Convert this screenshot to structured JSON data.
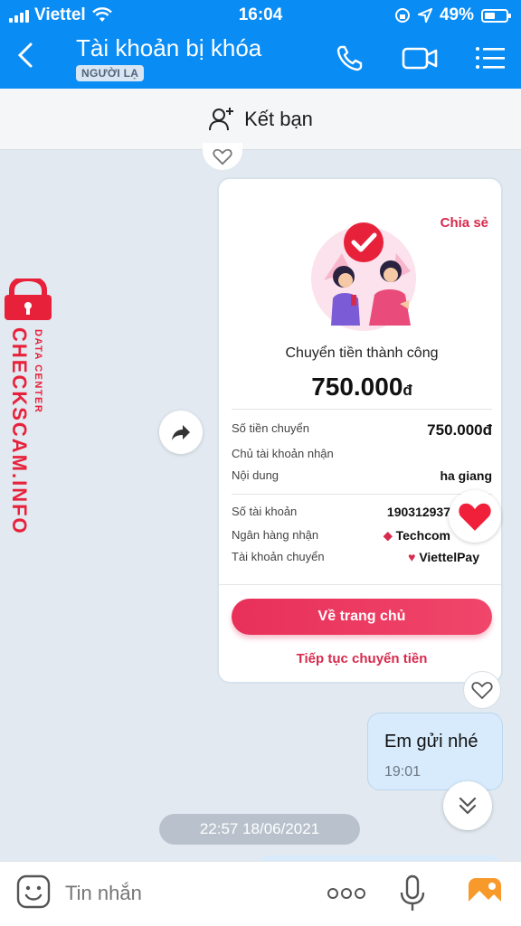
{
  "status_bar": {
    "carrier": "Viettel",
    "time": "16:04",
    "battery": "49%"
  },
  "header": {
    "back_icon": "chevron-left-icon",
    "title": "Tài khoản bị khóa",
    "badge": "NGƯỜI LẠ"
  },
  "friend_bar": {
    "label": "Kết bạn"
  },
  "card": {
    "share": "Chia sẻ",
    "success": "Chuyển tiền thành công",
    "amount": "750.000",
    "currency": "đ",
    "rows": [
      {
        "label": "Số tiền chuyển",
        "value": "750.000đ"
      },
      {
        "label": "Chủ tài khoản nhận",
        "value": ""
      },
      {
        "label": "Nội dung",
        "value": "ha giang"
      },
      {
        "label": "Số tài khoản",
        "value": "190312937"
      },
      {
        "label": "Ngân hàng nhận",
        "value": "Techcom"
      },
      {
        "label": "Tài khoản chuyển",
        "value": "ViettelPay"
      }
    ],
    "home_button": "Về trang chủ",
    "continue_link": "Tiếp tục chuyển tiền"
  },
  "message": {
    "text": "Em gửi nhé",
    "time": "19:01"
  },
  "timestamp": "22:57 18/06/2021",
  "composer": {
    "placeholder": "Tin nhắn"
  },
  "colors": {
    "header_blue": "#0a8cf5",
    "accent_red": "#e8305a",
    "bubble": "#d7ebfc"
  },
  "watermark": {
    "small": "DATA CENTER",
    "large": "CHECKSCAM.INFO"
  }
}
